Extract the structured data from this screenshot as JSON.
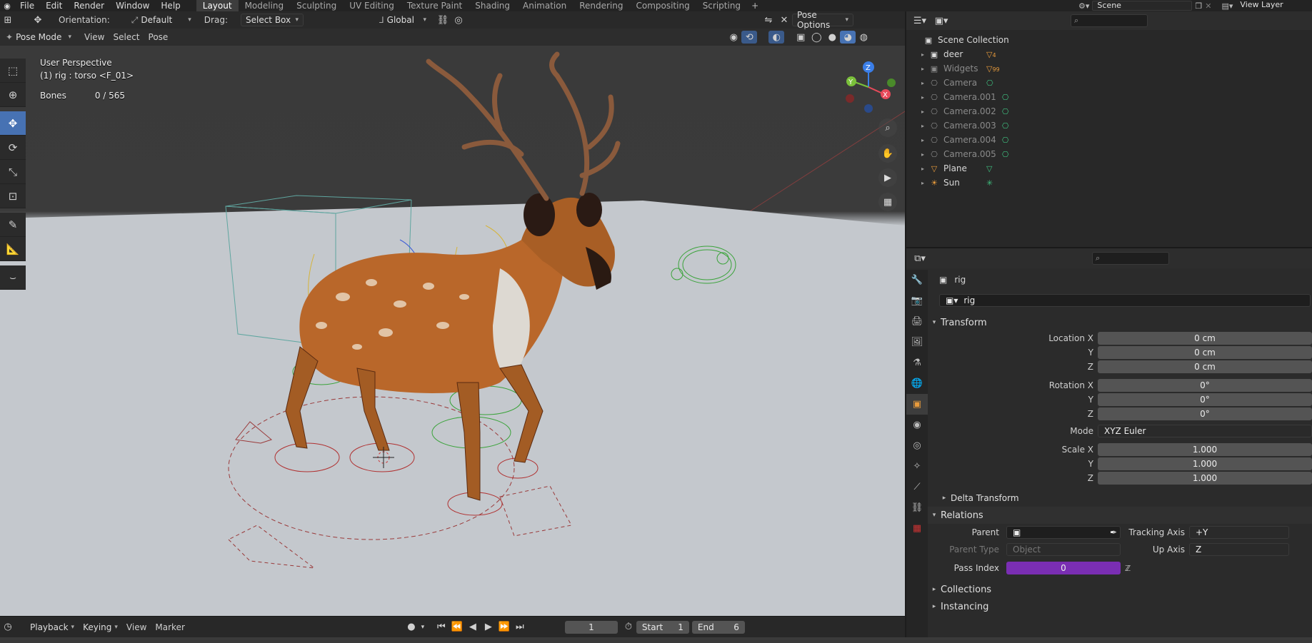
{
  "menu": {
    "items": [
      "File",
      "Edit",
      "Render",
      "Window",
      "Help"
    ],
    "workspaces": [
      "Layout",
      "Modeling",
      "Sculpting",
      "UV Editing",
      "Texture Paint",
      "Shading",
      "Animation",
      "Rendering",
      "Compositing",
      "Scripting"
    ],
    "active_workspace": "Layout",
    "scene": "Scene",
    "view_layer": "View Layer"
  },
  "viewport_header": {
    "orientation_label": "Orientation:",
    "orientation_value": "Default",
    "drag_label": "Drag:",
    "drag_value": "Select Box",
    "transform_orientation": "Global",
    "pose_options": "Pose Options",
    "mode": "Pose Mode",
    "view": "View",
    "select": "Select",
    "pose": "Pose"
  },
  "viewport_info": {
    "perspective": "User Perspective",
    "active": "(1) rig : torso <F_01>",
    "bones_label": "Bones",
    "bones_value": "0 / 565"
  },
  "gizmo": {
    "x": "X",
    "y": "Y",
    "z": "Z"
  },
  "timeline": {
    "playback": "Playback",
    "keying": "Keying",
    "view": "View",
    "marker": "Marker",
    "current_frame": "1",
    "start_label": "Start",
    "start_value": "1",
    "end_label": "End",
    "end_value": "6"
  },
  "outliner": {
    "root": "Scene Collection",
    "items": [
      {
        "name": "deer",
        "extra": "4",
        "dim": false
      },
      {
        "name": "Widgets",
        "extra": "99",
        "dim": true
      },
      {
        "name": "Camera",
        "extra": "",
        "dim": true
      },
      {
        "name": "Camera.001",
        "extra": "",
        "dim": true
      },
      {
        "name": "Camera.002",
        "extra": "",
        "dim": true
      },
      {
        "name": "Camera.003",
        "extra": "",
        "dim": true
      },
      {
        "name": "Camera.004",
        "extra": "",
        "dim": true
      },
      {
        "name": "Camera.005",
        "extra": "",
        "dim": true
      },
      {
        "name": "Plane",
        "extra": "",
        "dim": false
      },
      {
        "name": "Sun",
        "extra": "",
        "dim": false
      }
    ]
  },
  "properties": {
    "object_name": "rig",
    "object_field": "rig",
    "transform_title": "Transform",
    "location_x_label": "Location X",
    "location_x": "0 cm",
    "y_label": "Y",
    "location_y": "0 cm",
    "z_label": "Z",
    "location_z": "0 cm",
    "rotation_x_label": "Rotation X",
    "rotation_x": "0°",
    "rotation_y": "0°",
    "rotation_z": "0°",
    "mode_label": "Mode",
    "mode_value": "XYZ Euler",
    "scale_x_label": "Scale X",
    "scale_x": "1.000",
    "scale_y": "1.000",
    "scale_z": "1.000",
    "delta_transform": "Delta Transform",
    "relations_title": "Relations",
    "parent_label": "Parent",
    "parent_type_label": "Parent Type",
    "parent_type_value": "Object",
    "tracking_axis_label": "Tracking Axis",
    "tracking_axis_value": "+Y",
    "up_axis_label": "Up Axis",
    "up_axis_value": "Z",
    "pass_index_label": "Pass Index",
    "pass_index_value": "0",
    "collections": "Collections",
    "instancing": "Instancing"
  },
  "colors": {
    "accent_blue": "#4772b3",
    "pass_index_purple": "#7a2eb3",
    "orange_icon": "#e89b3c",
    "green_icon": "#3fbf7f"
  }
}
